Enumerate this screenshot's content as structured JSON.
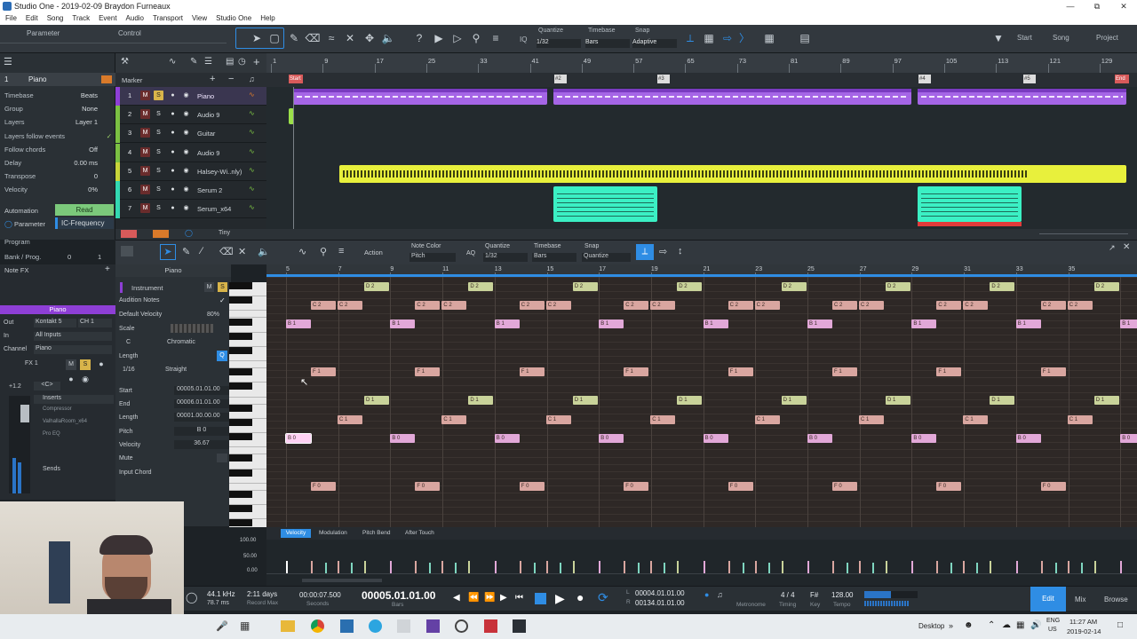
{
  "title": "Studio One - 2019-02-09 Braydon Furneaux",
  "menu": [
    "File",
    "Edit",
    "Song",
    "Track",
    "Event",
    "Audio",
    "Transport",
    "View",
    "Studio One",
    "Help"
  ],
  "toolbar": {
    "parameter": "Parameter",
    "control": "Control",
    "quantize_label": "Quantize",
    "quantize_value": "1/32",
    "timebase_label": "Timebase",
    "timebase_value": "Bars",
    "snap_label": "Snap",
    "snap_value": "Adaptive",
    "iq": "IQ",
    "start": "Start",
    "song": "Song",
    "project": "Project"
  },
  "inspector": {
    "track_num": "1",
    "track_name": "Piano",
    "rows": [
      {
        "k": "Timebase",
        "v": "Beats"
      },
      {
        "k": "Group",
        "v": "None"
      },
      {
        "k": "Layers",
        "v": "Layer 1"
      },
      {
        "k": "Layers follow events",
        "v": ""
      },
      {
        "k": "Follow chords",
        "v": "Off"
      },
      {
        "k": "Delay",
        "v": "0.00 ms"
      },
      {
        "k": "Transpose",
        "v": "0"
      },
      {
        "k": "Velocity",
        "v": "0%"
      }
    ],
    "automation": "Automation",
    "automation_mode": "Read",
    "parameter": "Parameter",
    "parameter_value": "IC-Frequency",
    "program": "Program",
    "bank": "Bank / Prog.",
    "bank_v1": "0",
    "bank_v2": "1"
  },
  "ruler_marks": [
    "1",
    "9",
    "17",
    "25",
    "33",
    "41",
    "49",
    "57",
    "65",
    "73",
    "81",
    "89",
    "97",
    "105",
    "113",
    "121",
    "129"
  ],
  "marker_label": "Marker",
  "marker_flags": [
    "Start",
    "#2",
    "#3",
    "#4",
    "#5",
    "End"
  ],
  "tracks": [
    {
      "num": "1",
      "name": "Piano",
      "color": "#8e3fd6"
    },
    {
      "num": "2",
      "name": "Audio 9",
      "color": "#7bc043"
    },
    {
      "num": "3",
      "name": "Guitar",
      "color": "#7bc043"
    },
    {
      "num": "4",
      "name": "Audio 9",
      "color": "#7bc043"
    },
    {
      "num": "5",
      "name": "Halsey-Wi..nly)",
      "color": "#c8d53a"
    },
    {
      "num": "6",
      "name": "Serum 2",
      "color": "#33d9b2"
    },
    {
      "num": "7",
      "name": "Serum_x64",
      "color": "#33d9b2"
    }
  ],
  "tiny": "Tiny",
  "editor": {
    "action": "Action",
    "note_color_label": "Note Color",
    "note_color_value": "Pitch",
    "quantize_label": "Quantize",
    "quantize_value": "1/32",
    "timebase_label": "Timebase",
    "timebase_value": "Bars",
    "snap_label": "Snap",
    "snap_value": "Quantize",
    "aq": "AQ",
    "piano_title": "Piano",
    "instrument": "Instrument",
    "audition": "Audition Notes",
    "default_velocity": "Default Velocity",
    "default_velocity_v": "80%",
    "scale": "Scale",
    "scale_key": "C",
    "scale_type": "Chromatic",
    "length_label": "Length",
    "length_v": "1/16",
    "length_mode": "Straight",
    "start": "Start",
    "start_v": "00005.01.01.00",
    "end": "End",
    "end_v": "00006.01.01.00",
    "length2": "Length",
    "length2_v": "00001.00.00.00",
    "pitch": "Pitch",
    "pitch_v": "B 0",
    "velocity": "Velocity",
    "velocity_v": "36.67",
    "mute": "Mute",
    "input_chord": "Input Chord"
  },
  "left_panel": {
    "note_fx": "Note FX",
    "piano": "Piano",
    "out": "Out",
    "out_v": "Kontakt 5",
    "ch": "CH 1",
    "in": "In",
    "in_v": "All Inputs",
    "channel": "Channel",
    "channel_v": "Piano",
    "fx": "FX 1",
    "pan": "+1.2",
    "pan2": "<C>",
    "inserts": "Inserts",
    "insert_items": [
      "Compressor",
      "ValhallaRoom_x64",
      "Pro EQ"
    ],
    "sends": "Sends"
  },
  "pr_ruler": [
    "5",
    "7",
    "9",
    "11",
    "13",
    "15",
    "17",
    "19",
    "21",
    "23",
    "25",
    "27",
    "29",
    "31",
    "33",
    "35"
  ],
  "vel_tabs": [
    "Velocity",
    "Modulation",
    "Pitch Bend",
    "After Touch"
  ],
  "vel_axis": [
    "100.00",
    "50.00",
    "0.00"
  ],
  "transport": {
    "rate": "44.1 kHz",
    "latency": "78.7 ms",
    "days": "2:11 days",
    "record_max": "Record Max",
    "seconds_v": "00:00:07.500",
    "seconds": "Seconds",
    "bars_v": "00005.01.01.00",
    "bars": "Bars",
    "loop_l": "00004.01.01.00",
    "loop_r": "00134.01.01.00",
    "metronome": "Metronome",
    "timing_v": "4 / 4",
    "timing": "Timing",
    "key_v": "F#",
    "key": "Key",
    "tempo_v": "128.00",
    "tempo": "Tempo",
    "edit": "Edit",
    "mix": "Mix",
    "browse": "Browse"
  },
  "taskbar": {
    "desktop": "Desktop",
    "lang1": "ENG",
    "lang2": "US",
    "time": "11:27 AM",
    "date": "2019-02-14"
  }
}
